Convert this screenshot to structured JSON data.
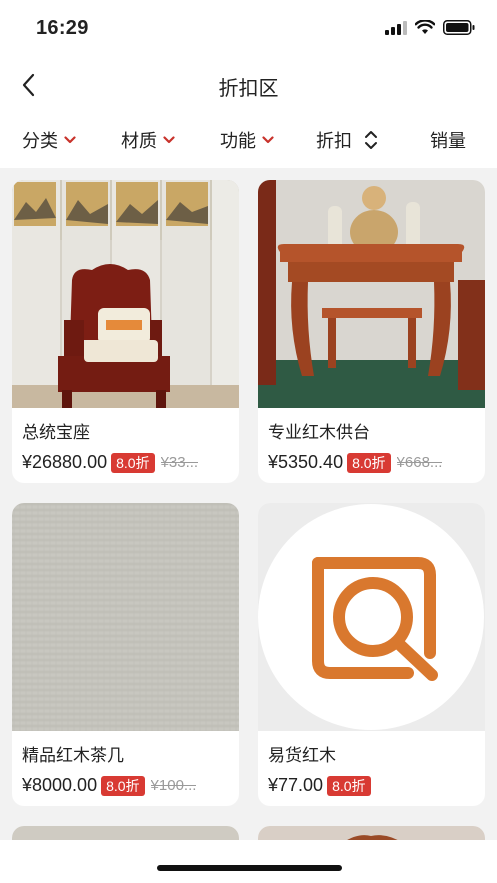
{
  "status_bar": {
    "time": "16:29"
  },
  "nav": {
    "title": "折扣区"
  },
  "filters": [
    {
      "label": "分类"
    },
    {
      "label": "材质"
    },
    {
      "label": "功能"
    },
    {
      "label": "折扣"
    },
    {
      "label": "销量"
    }
  ],
  "products": [
    {
      "name": "总统宝座",
      "price": "¥26880.00",
      "discount": "8.0折",
      "original_price": "¥33..."
    },
    {
      "name": "专业红木供台",
      "price": "¥5350.40",
      "discount": "8.0折",
      "original_price": "¥668..."
    },
    {
      "name": "精品红木茶几",
      "price": "¥8000.00",
      "discount": "8.0折",
      "original_price": "¥100..."
    },
    {
      "name": "易货红木",
      "price": "¥77.00",
      "discount": "8.0折"
    }
  ],
  "colors": {
    "accent": "#d83a33",
    "logo": "#d9782e",
    "background": "#f2f2f2"
  }
}
